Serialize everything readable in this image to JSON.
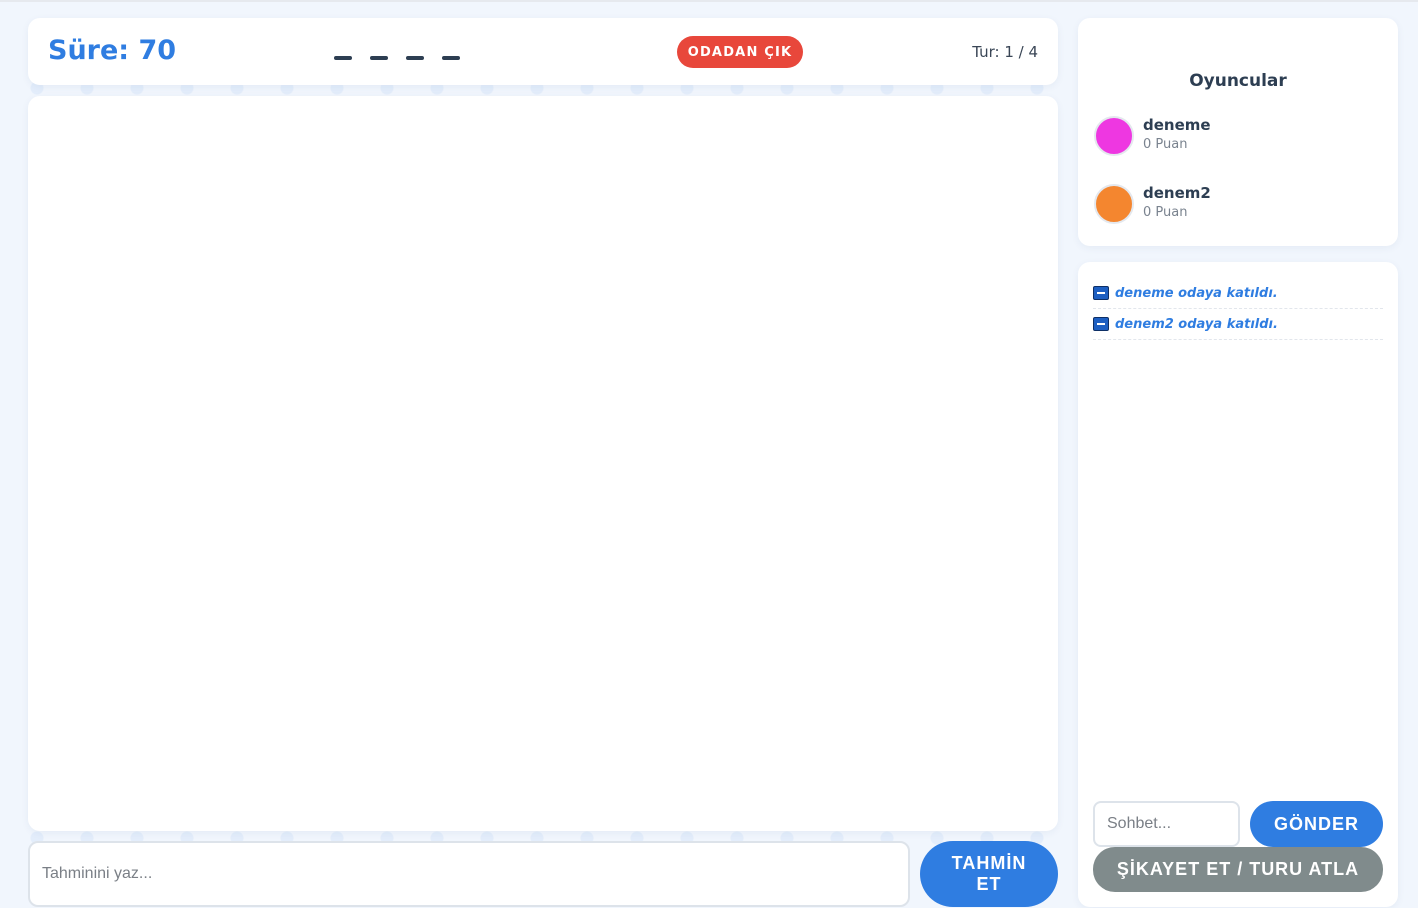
{
  "header": {
    "timer_label": "Süre: 70",
    "word_blanks": 4,
    "leave_button": "ODADAN ÇIK",
    "round_label": "Tur: 1 / 4"
  },
  "guess": {
    "placeholder": "Tahminini yaz...",
    "button_label": "TAHMİN ET"
  },
  "players": {
    "title": "Oyuncular",
    "list": [
      {
        "name": "deneme",
        "score": "0 Puan",
        "color": "#ee37e1"
      },
      {
        "name": "denem2",
        "score": "0 Puan",
        "color": "#f4862f"
      }
    ]
  },
  "chat": {
    "messages": [
      {
        "icon": "arrow-right-icon",
        "text": "deneme odaya katıldı."
      },
      {
        "icon": "arrow-right-icon",
        "text": "denem2 odaya katıldı."
      }
    ],
    "placeholder": "Sohbet...",
    "send_button": "GÖNDER",
    "report_button": "ŞİKAYET ET / TURU ATLA"
  },
  "colors": {
    "accent": "#2f7de1",
    "danger": "#e8473b",
    "muted_button": "#808b8c"
  }
}
